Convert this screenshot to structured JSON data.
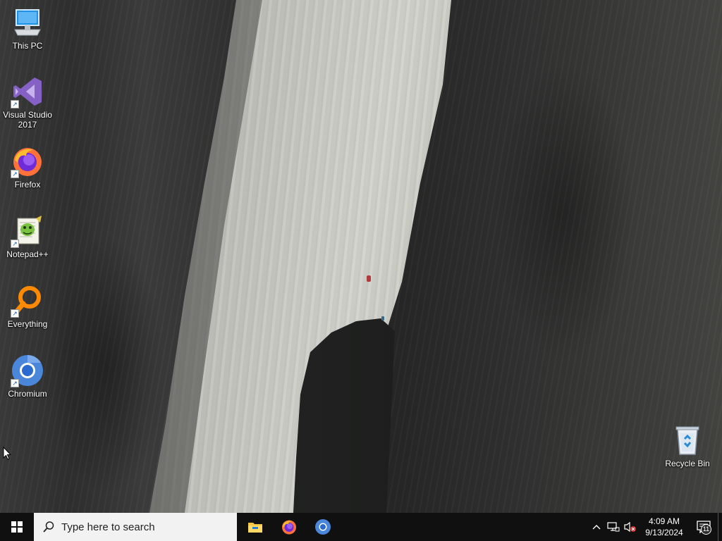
{
  "desktop": {
    "icons": [
      {
        "label": "This PC",
        "icon": "this-pc-icon",
        "shortcut": false
      },
      {
        "label": "Visual Studio 2017",
        "icon": "visual-studio-icon",
        "shortcut": true
      },
      {
        "label": "Firefox",
        "icon": "firefox-icon",
        "shortcut": true
      },
      {
        "label": "Notepad++",
        "icon": "notepadpp-icon",
        "shortcut": true
      },
      {
        "label": "Everything",
        "icon": "everything-icon",
        "shortcut": true
      },
      {
        "label": "Chromium",
        "icon": "chromium-icon",
        "shortcut": true
      }
    ],
    "recycle_bin": {
      "label": "Recycle Bin",
      "icon": "recycle-bin-icon"
    }
  },
  "taskbar": {
    "search_placeholder": "Type here to search",
    "pinned_apps": [
      {
        "name": "File Explorer",
        "icon": "file-explorer-icon"
      },
      {
        "name": "Firefox",
        "icon": "firefox-icon"
      },
      {
        "name": "Chromium",
        "icon": "chromium-icon"
      }
    ],
    "tray": {
      "time": "4:09 AM",
      "date": "9/13/2024",
      "notification_count": "11"
    }
  },
  "colors": {
    "taskbar_bg": "#101010",
    "search_bg": "#f2f2f2",
    "accent": "#7fb3e0"
  }
}
